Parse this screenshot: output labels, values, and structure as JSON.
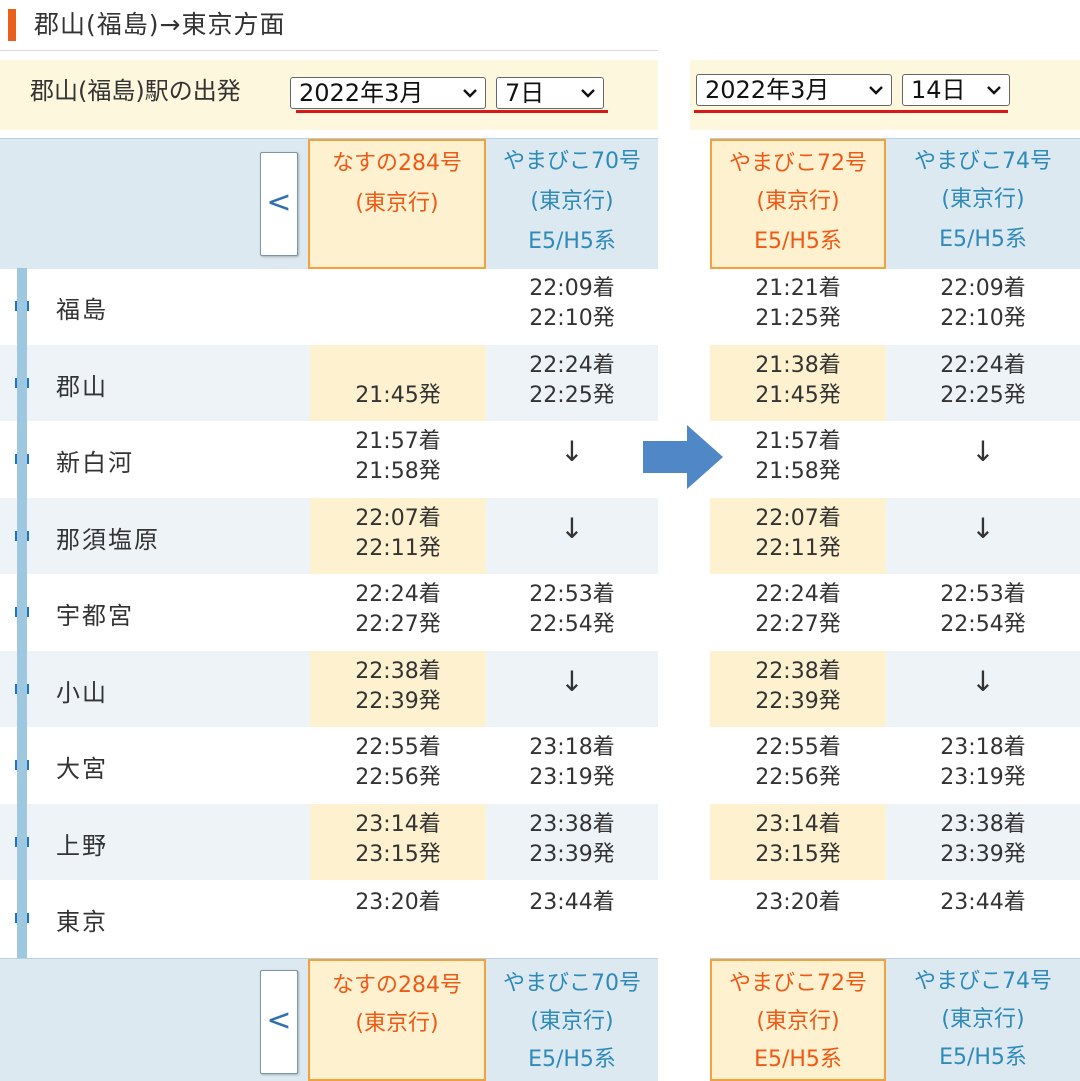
{
  "title": "郡山(福島)→東京方面",
  "left": {
    "depart_label": "郡山(福島)駅の出発",
    "month_select": "2022年3月",
    "day_select": "7日",
    "prev_label": "<",
    "trains": [
      {
        "name": "なすの284号",
        "dest": "(東京行)",
        "series": "",
        "highlight": true
      },
      {
        "name": "やまびこ70号",
        "dest": "(東京行)",
        "series": "E5/H5系",
        "highlight": false
      }
    ]
  },
  "right": {
    "month_select": "2022年3月",
    "day_select": "14日",
    "trains": [
      {
        "name": "やまびこ72号",
        "dest": "(東京行)",
        "series": "E5/H5系",
        "highlight": true
      },
      {
        "name": "やまびこ74号",
        "dest": "(東京行)",
        "series": "E5/H5系",
        "highlight": false
      }
    ]
  },
  "stations": [
    "福島",
    "郡山",
    "新白河",
    "那須塩原",
    "宇都宮",
    "小山",
    "大宮",
    "上野",
    "東京"
  ],
  "left_times": [
    [
      [
        ""
      ],
      [
        "22:09着",
        "22:10発"
      ]
    ],
    [
      [
        "",
        "21:45発"
      ],
      [
        "22:24着",
        "22:25発"
      ]
    ],
    [
      [
        "21:57着",
        "21:58発"
      ],
      [
        "↓"
      ]
    ],
    [
      [
        "22:07着",
        "22:11発"
      ],
      [
        "↓"
      ]
    ],
    [
      [
        "22:24着",
        "22:27発"
      ],
      [
        "22:53着",
        "22:54発"
      ]
    ],
    [
      [
        "22:38着",
        "22:39発"
      ],
      [
        "↓"
      ]
    ],
    [
      [
        "22:55着",
        "22:56発"
      ],
      [
        "23:18着",
        "23:19発"
      ]
    ],
    [
      [
        "23:14着",
        "23:15発"
      ],
      [
        "23:38着",
        "23:39発"
      ]
    ],
    [
      [
        "23:20着"
      ],
      [
        "23:44着"
      ]
    ]
  ],
  "right_times": [
    [
      [
        "21:21着",
        "21:25発"
      ],
      [
        "22:09着",
        "22:10発"
      ]
    ],
    [
      [
        "21:38着",
        "21:45発"
      ],
      [
        "22:24着",
        "22:25発"
      ]
    ],
    [
      [
        "21:57着",
        "21:58発"
      ],
      [
        "↓"
      ]
    ],
    [
      [
        "22:07着",
        "22:11発"
      ],
      [
        "↓"
      ]
    ],
    [
      [
        "22:24着",
        "22:27発"
      ],
      [
        "22:53着",
        "22:54発"
      ]
    ],
    [
      [
        "22:38着",
        "22:39発"
      ],
      [
        "↓"
      ]
    ],
    [
      [
        "22:55着",
        "22:56発"
      ],
      [
        "23:18着",
        "23:19発"
      ]
    ],
    [
      [
        "23:14着",
        "23:15発"
      ],
      [
        "23:38着",
        "23:39発"
      ]
    ],
    [
      [
        "23:20着"
      ],
      [
        "23:44着"
      ]
    ]
  ],
  "colors": {
    "accent": "#e8601c",
    "highlight_bg": "#fdf1cf",
    "highlight_text": "#ee5a16",
    "train_text": "#2e8ab8",
    "underline": "#d61a1a",
    "arrow": "#4f87c7"
  }
}
